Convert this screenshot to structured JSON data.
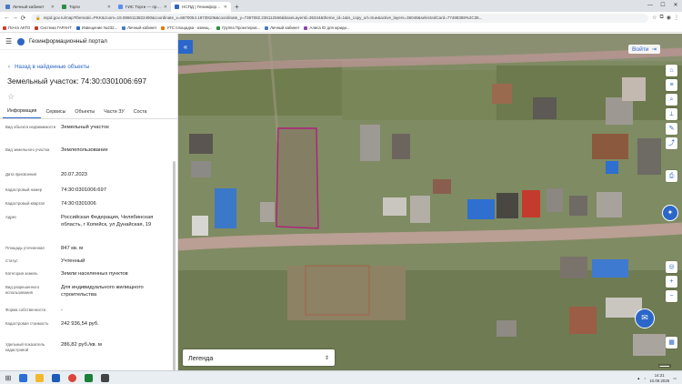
{
  "browser": {
    "tabs": [
      {
        "label": "Личный кабинет",
        "color": "#4a78c4"
      },
      {
        "label": "Торги",
        "color": "#2d8d46"
      },
      {
        "label": "ГИС Торги — продажа государст...",
        "color": "#5b8def"
      },
      {
        "label": "НСПД | Геоинформационный п...",
        "color": "#2f64c1",
        "active": true
      }
    ],
    "new_tab": "+",
    "url": "nspd.gov.ru/map?thematic=PKK&zoom=19.0866113822490&coordinate_x=6870054.19739106&coordinate_y=7397082.236112566&baseLayerId=36344&theme_id=1&is_copy_url=true&active_layers=36048&selectedCard=77488388%2C36...",
    "bookmarks": [
      {
        "label": "Почта АКТО",
        "color": "#d33b2c"
      },
      {
        "label": "Система ГАРАНТ",
        "color": "#c0392b"
      },
      {
        "label": "Извещение №232...",
        "color": "#2b66c9"
      },
      {
        "label": "Личный кабинет",
        "color": "#4a78c4"
      },
      {
        "label": "УТС площадка - извещ...",
        "color": "#e07b00"
      },
      {
        "label": "Группа Проектиров...",
        "color": "#2d8d46"
      },
      {
        "label": "Личный кабинет",
        "color": "#4a78c4"
      },
      {
        "label": "Алиса ID для юриди...",
        "color": "#8e44ad"
      }
    ]
  },
  "portal": {
    "title": "Геоинформационный портал",
    "back_label": "Назад в найденные объекты",
    "parcel_title": "Земельный участок: 74:30:0301006:697",
    "tabs": [
      "Информация",
      "Сервисы",
      "Объекты",
      "Части ЗУ",
      "Соста"
    ],
    "properties": [
      {
        "label": "Вид объекта недвижимости",
        "value": "Земельный участок"
      },
      {
        "label": "Вид земельного участка",
        "value": "Землепользование"
      },
      {
        "label": "Дата присвоения",
        "value": "20.07.2023"
      },
      {
        "label": "Кадастровый номер",
        "value": "74:30:0301006:697"
      },
      {
        "label": "Кадастровый квартал",
        "value": "74:30:0301006"
      },
      {
        "label": "Адрес",
        "value": "Российская Федерация, Челябинская область, г Копейск, ул Дунайская, 19"
      },
      {
        "label": "Площадь уточненная",
        "value": "847 кв. м"
      },
      {
        "label": "Статус",
        "value": "Учтенный"
      },
      {
        "label": "Категория земель",
        "value": "Земли населенных пунктов"
      },
      {
        "label": "Вид разрешенного использования",
        "value": "Для индивидуального жилищного строительства"
      },
      {
        "label": "Форма собственности",
        "value": "-"
      },
      {
        "label": "Кадастровая стоимость",
        "value": "242 936,54 руб."
      },
      {
        "label": "Удельный показатель кадастровой",
        "value": "286,82 руб./кв. м"
      }
    ]
  },
  "map": {
    "login_label": "Войти",
    "legend_label": "Легенда",
    "accent": "#2b66c9",
    "parcel_outline": "#b0207a"
  },
  "taskbar": {
    "time": "14:21",
    "date": "10.09.2025",
    "apps": [
      "#2b6fd6",
      "#f3b829",
      "#1e5bb8",
      "#db4437",
      "#1a7f37",
      "#444444"
    ]
  }
}
